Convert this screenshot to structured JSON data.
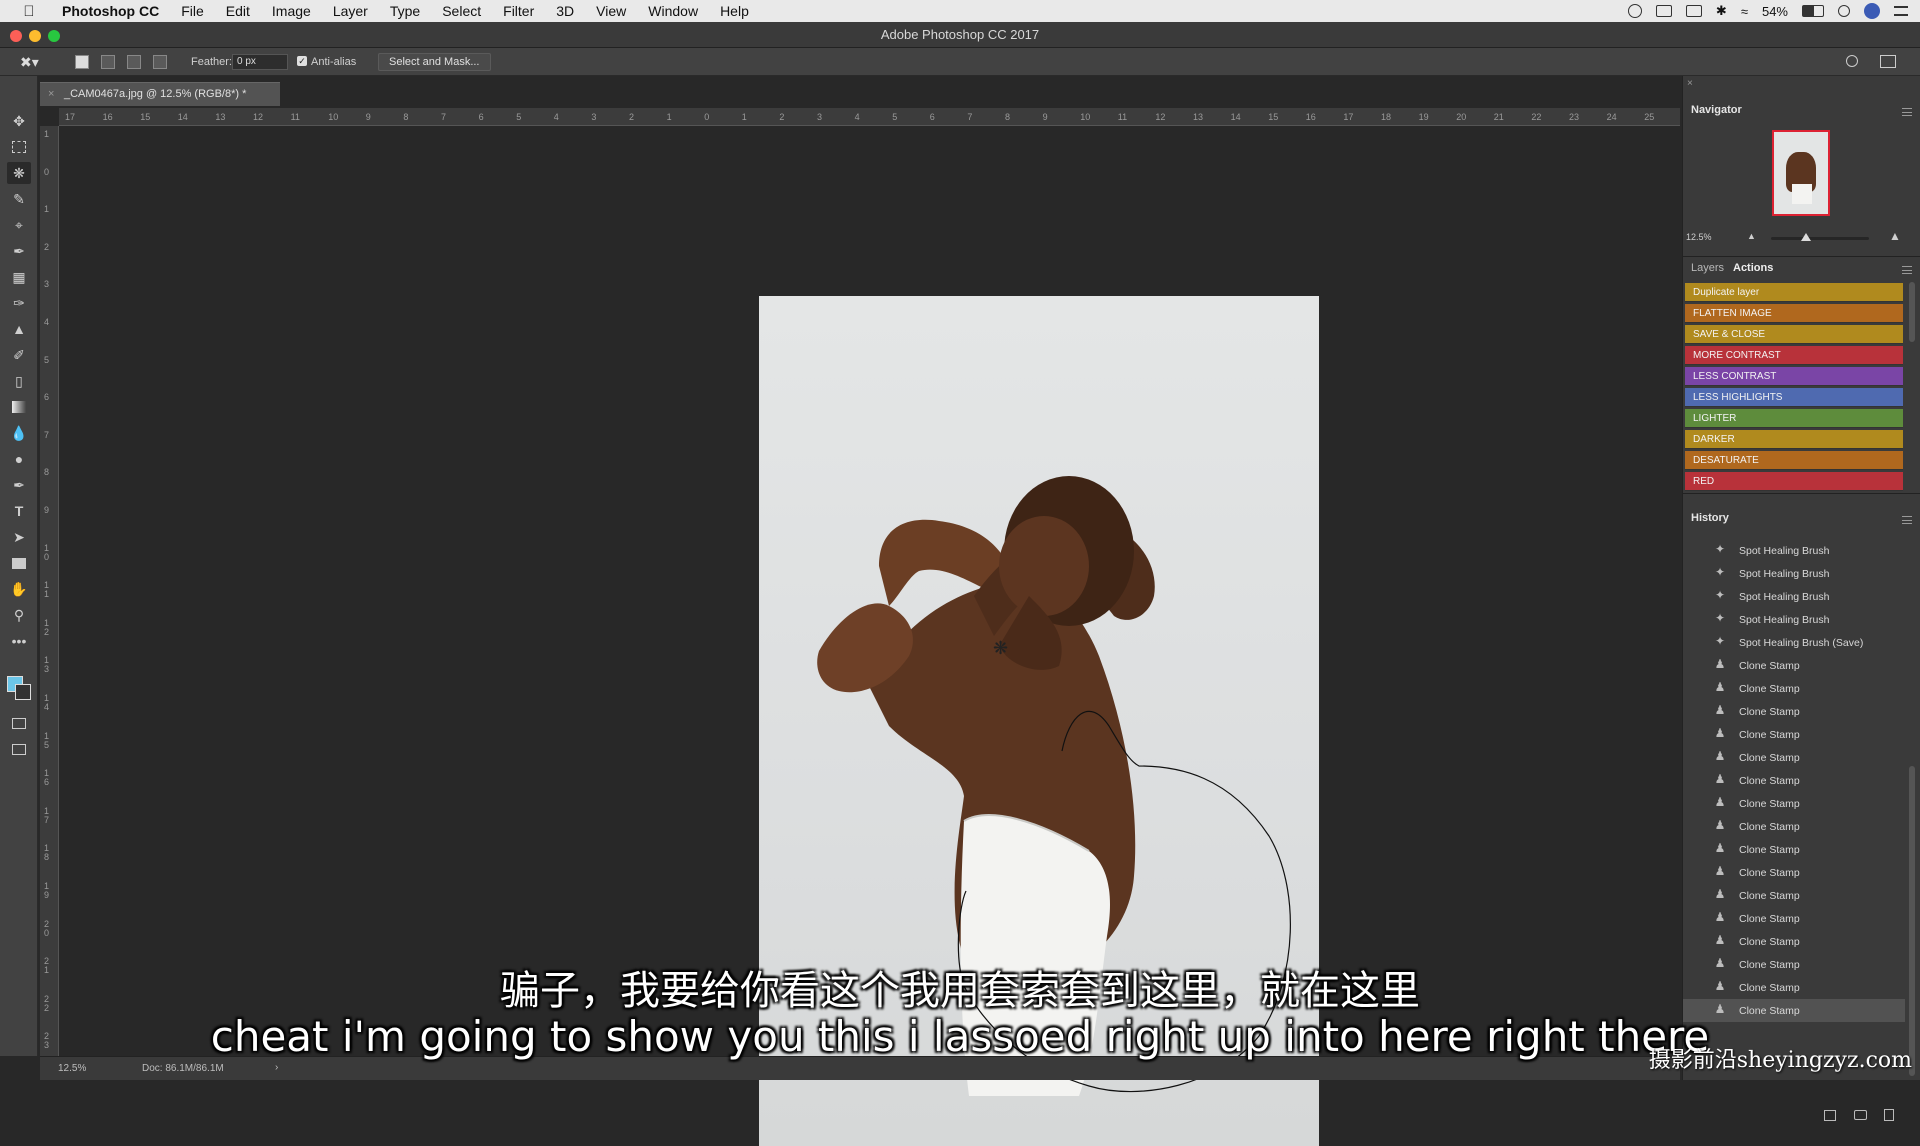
{
  "menubar": {
    "app_name": "Photoshop CC",
    "items": [
      "File",
      "Edit",
      "Image",
      "Layer",
      "Type",
      "Select",
      "Filter",
      "3D",
      "View",
      "Window",
      "Help"
    ],
    "battery": "54%"
  },
  "window": {
    "title": "Adobe Photoshop CC 2017"
  },
  "options": {
    "feather_label": "Feather:",
    "feather_value": "0 px",
    "antialias_label": "Anti-alias",
    "select_mask_label": "Select and Mask..."
  },
  "document": {
    "tab_title": "_CAM0467a.jpg @ 12.5% (RGB/8*) *",
    "zoom": "12.5%",
    "doc_size": "Doc: 86.1M/86.1M",
    "ruler_top": [
      "17",
      "16",
      "15",
      "14",
      "13",
      "12",
      "11",
      "10",
      "9",
      "8",
      "7",
      "6",
      "5",
      "4",
      "3",
      "2",
      "1",
      "0",
      "1",
      "2",
      "3",
      "4",
      "5",
      "6",
      "7",
      "8",
      "9",
      "10",
      "11",
      "12",
      "13",
      "14",
      "15",
      "16",
      "17",
      "18",
      "19",
      "20",
      "21",
      "22",
      "23",
      "24",
      "25"
    ],
    "ruler_left": [
      "1",
      "0",
      "1",
      "2",
      "3",
      "4",
      "5",
      "6",
      "7",
      "8",
      "9",
      "1\n0",
      "1\n1",
      "1\n2",
      "1\n3",
      "1\n4",
      "1\n5",
      "1\n6",
      "1\n7",
      "1\n8",
      "1\n9",
      "2\n0",
      "2\n1",
      "2\n2",
      "2\n3"
    ]
  },
  "navigator": {
    "title": "Navigator",
    "zoom": "12.5%"
  },
  "actions_panel": {
    "tab_layers": "Layers",
    "tab_actions": "Actions",
    "items": [
      {
        "label": "Duplicate layer",
        "color": "#b08a1e"
      },
      {
        "label": "FLATTEN IMAGE",
        "color": "#b0681e"
      },
      {
        "label": "SAVE & CLOSE",
        "color": "#b08a1e"
      },
      {
        "label": "MORE CONTRAST",
        "color": "#b8323a"
      },
      {
        "label": "LESS CONTRAST",
        "color": "#7a45a6"
      },
      {
        "label": "LESS HIGHLIGHTS",
        "color": "#4f6ab0"
      },
      {
        "label": "LIGHTER",
        "color": "#5e8c3c"
      },
      {
        "label": "DARKER",
        "color": "#b08a1e"
      },
      {
        "label": "DESATURATE",
        "color": "#b0681e"
      },
      {
        "label": "RED",
        "color": "#b8323a"
      }
    ]
  },
  "history": {
    "title": "History",
    "items": [
      {
        "label": "Spot Healing Brush",
        "icon": "bandage-icon"
      },
      {
        "label": "Spot Healing Brush",
        "icon": "bandage-icon"
      },
      {
        "label": "Spot Healing Brush",
        "icon": "bandage-icon"
      },
      {
        "label": "Spot Healing Brush",
        "icon": "bandage-icon"
      },
      {
        "label": "Spot Healing Brush (Save)",
        "icon": "bandage-icon"
      },
      {
        "label": "Clone Stamp",
        "icon": "stamp-icon"
      },
      {
        "label": "Clone Stamp",
        "icon": "stamp-icon"
      },
      {
        "label": "Clone Stamp",
        "icon": "stamp-icon"
      },
      {
        "label": "Clone Stamp",
        "icon": "stamp-icon"
      },
      {
        "label": "Clone Stamp",
        "icon": "stamp-icon"
      },
      {
        "label": "Clone Stamp",
        "icon": "stamp-icon"
      },
      {
        "label": "Clone Stamp",
        "icon": "stamp-icon"
      },
      {
        "label": "Clone Stamp",
        "icon": "stamp-icon"
      },
      {
        "label": "Clone Stamp",
        "icon": "stamp-icon"
      },
      {
        "label": "Clone Stamp",
        "icon": "stamp-icon"
      },
      {
        "label": "Clone Stamp",
        "icon": "stamp-icon"
      },
      {
        "label": "Clone Stamp",
        "icon": "stamp-icon"
      },
      {
        "label": "Clone Stamp",
        "icon": "stamp-icon"
      },
      {
        "label": "Clone Stamp",
        "icon": "stamp-icon"
      },
      {
        "label": "Clone Stamp",
        "icon": "stamp-icon"
      },
      {
        "label": "Clone Stamp",
        "icon": "stamp-icon"
      }
    ]
  },
  "subtitles": {
    "chinese": "骗子，我要给你看这个我用套索套到这里，就在这里",
    "english": "cheat i'm going to show you this i lassoed right up into here right there"
  },
  "watermark": "摄影前沿sheyingzyz.com"
}
